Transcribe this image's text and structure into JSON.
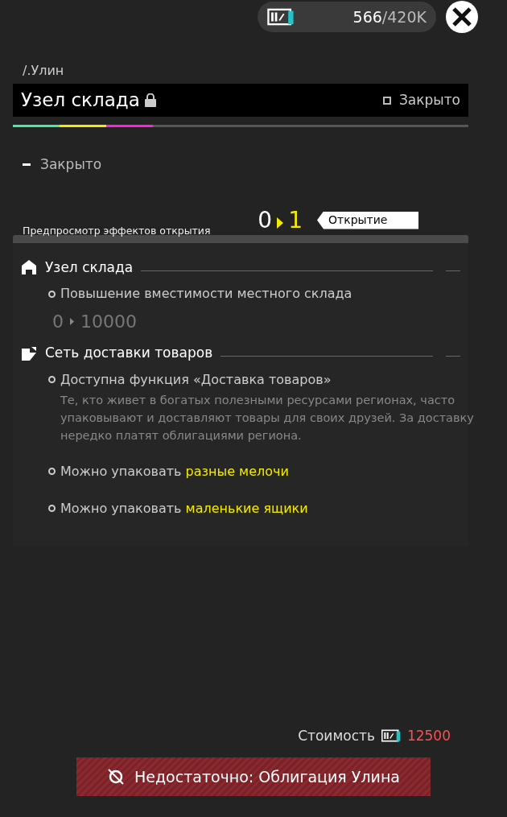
{
  "currency": {
    "current": "566",
    "max": "/420K"
  },
  "breadcrumb": "/.Улин",
  "title": {
    "text": "Узел склада",
    "locked": true,
    "status": "Закрыто"
  },
  "progress_segments": [
    {
      "color": "#4de8a0"
    },
    {
      "color": "#f5e900"
    },
    {
      "color": "#ff22dd"
    }
  ],
  "state_label": "Закрыто",
  "level_change": {
    "from": "0",
    "to": "1",
    "badge": "Открытие"
  },
  "preview": {
    "title": "Предпросмотр эффектов открытия",
    "sections": [
      {
        "kind": "warehouse",
        "name": "Узел склада",
        "effects": [
          {
            "text": "Повышение вместимости местного склада",
            "from": "0",
            "to": "10000"
          }
        ]
      },
      {
        "kind": "delivery",
        "name": "Сеть доставки товаров",
        "effects": [
          {
            "text": "Доступна функция «Доставка товаров»",
            "description": "Те, кто живет в богатых полезными ресурсами регионах, часто упаковывают и доставляют товары для своих друзей. За доставку нередко платят облигациями региона."
          },
          {
            "text": "Можно упаковать **разные мелочи**"
          },
          {
            "text": "Можно упаковать **маленькие ящики**"
          }
        ]
      }
    ]
  },
  "cost": {
    "label": "Стоимость",
    "amount": "12500",
    "insufficient": true
  },
  "warning": "Недостаточно: Облигация Улина"
}
